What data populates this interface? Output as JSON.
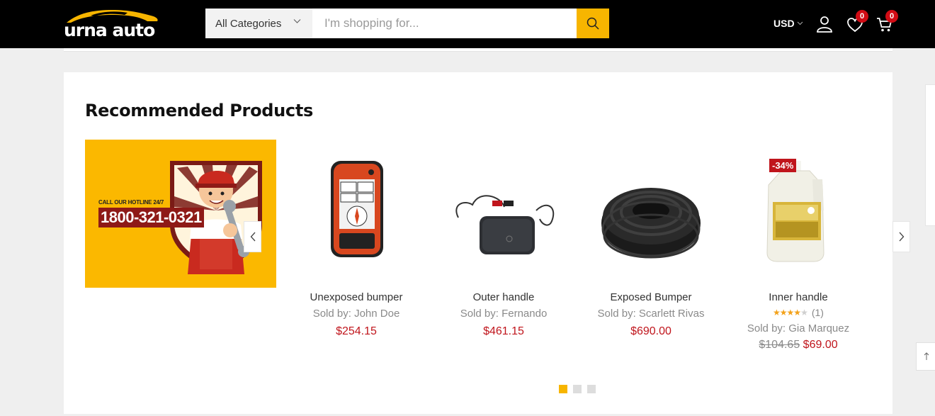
{
  "header": {
    "logo_text": "urna auto",
    "category_select": "All Categories",
    "search_placeholder": "I'm shopping for...",
    "currency": "USD",
    "wishlist_count": "0",
    "cart_count": "0"
  },
  "section": {
    "title": "Recommended Products"
  },
  "banner": {
    "hotline_label": "CALL OUR HOTLINE 24/7",
    "hotline_number": "1800-321-0321"
  },
  "products": [
    {
      "name": "Unexposed bumper",
      "seller": "Sold by: John Doe",
      "price": "$254.15"
    },
    {
      "name": "Outer handle",
      "seller": "Sold by: Fernando",
      "price": "$461.15"
    },
    {
      "name": "Exposed Bumper",
      "seller": "Sold by: Scarlett Rivas",
      "price": "$690.00"
    },
    {
      "name": "Inner handle",
      "seller": "Sold by: Gia Marquez",
      "old_price": "$104.65",
      "price": "$69.00",
      "discount": "-34%",
      "rating": 4,
      "rating_count": "(1)"
    }
  ],
  "carousel": {
    "pages": 3,
    "active_page": 1
  },
  "colors": {
    "accent": "#f7b500",
    "price": "#c0151c",
    "header_bg": "#000000"
  }
}
